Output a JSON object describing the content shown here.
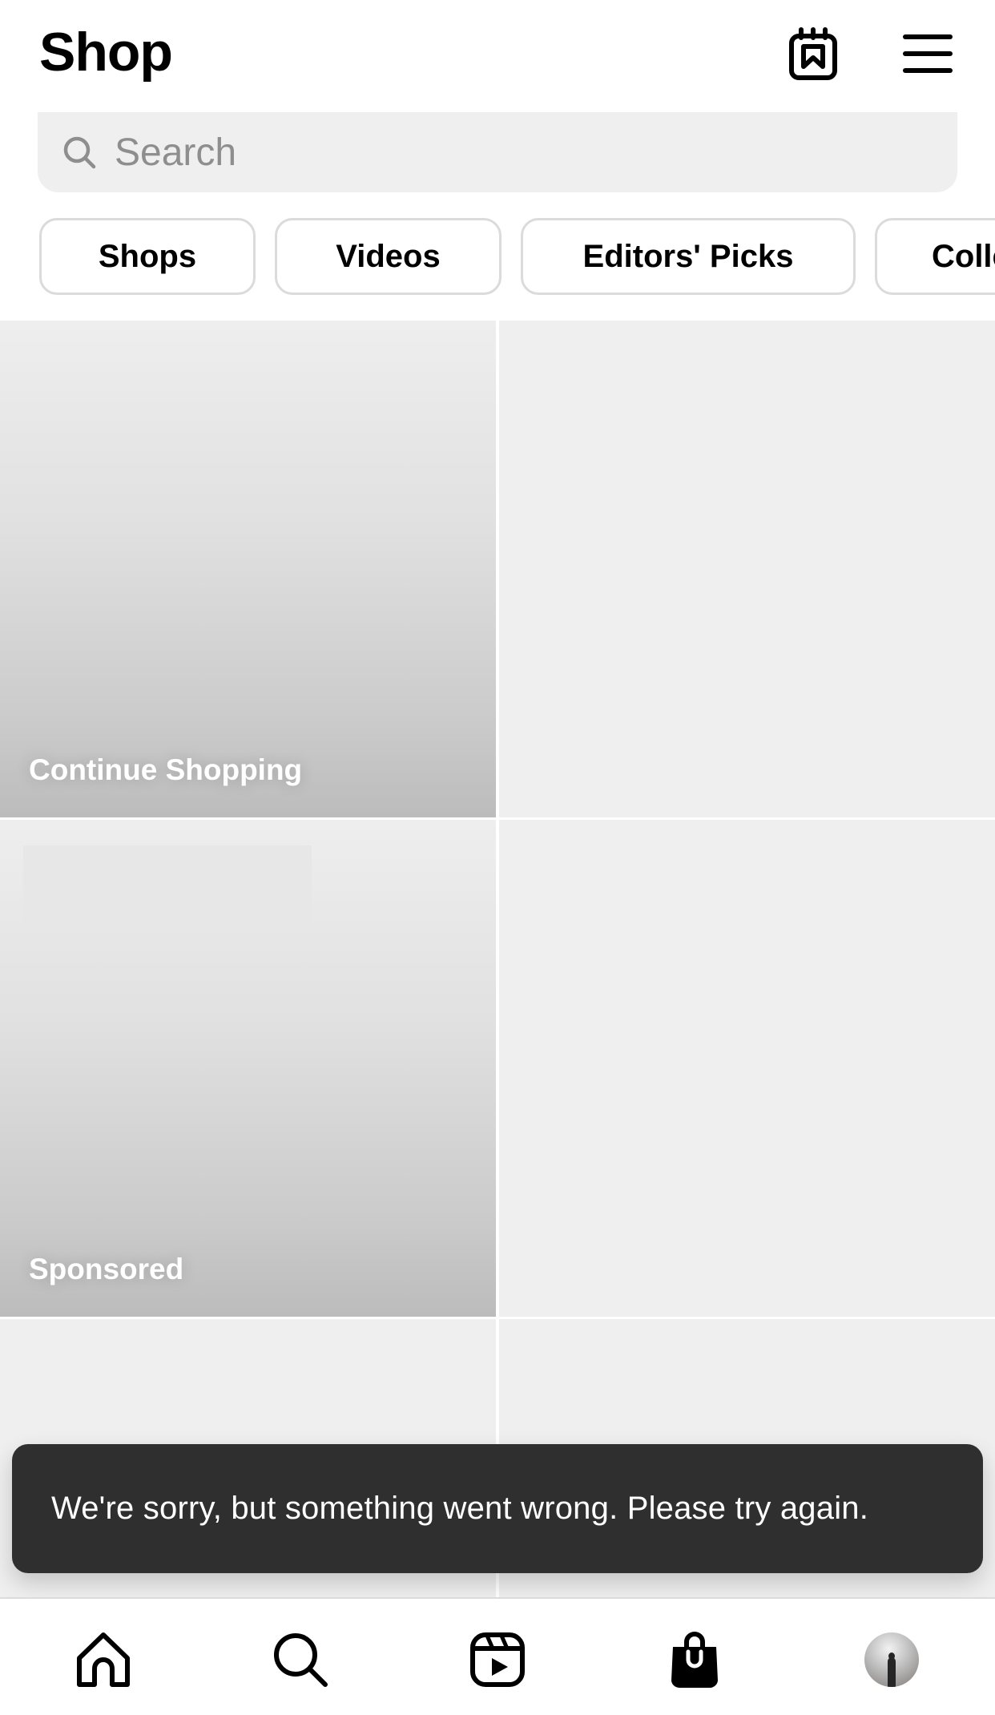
{
  "header": {
    "title": "Shop",
    "icons": [
      "saved-collections-icon",
      "menu-icon"
    ]
  },
  "search": {
    "placeholder": "Search",
    "value": "",
    "icon": "search-icon"
  },
  "chips": [
    {
      "label": "Shops"
    },
    {
      "label": "Videos"
    },
    {
      "label": "Editors' Picks"
    },
    {
      "label": "Collections"
    }
  ],
  "grid": {
    "tiles": [
      {
        "label": "Continue Shopping",
        "loaded": true
      },
      {
        "label": "",
        "loaded": false
      },
      {
        "label": "Sponsored",
        "loaded": true
      },
      {
        "label": "",
        "loaded": false
      },
      {
        "label": "",
        "loaded": false
      },
      {
        "label": "",
        "loaded": false
      }
    ]
  },
  "toast": {
    "message": "We're sorry, but something went wrong. Please try again."
  },
  "nav": {
    "items": [
      {
        "name": "home",
        "icon": "home-icon"
      },
      {
        "name": "search",
        "icon": "search-icon"
      },
      {
        "name": "reels",
        "icon": "reels-icon"
      },
      {
        "name": "shop",
        "icon": "shopping-bag-icon",
        "active": true
      },
      {
        "name": "profile",
        "icon": "avatar"
      }
    ]
  },
  "colors": {
    "background": "#ffffff",
    "placeholder_tile": "#efefef",
    "search_bg": "#efefef",
    "chip_border": "#dbdbdb",
    "toast_bg": "#2f2f2f",
    "text_primary": "#000000",
    "text_muted": "#8e8e8e"
  }
}
